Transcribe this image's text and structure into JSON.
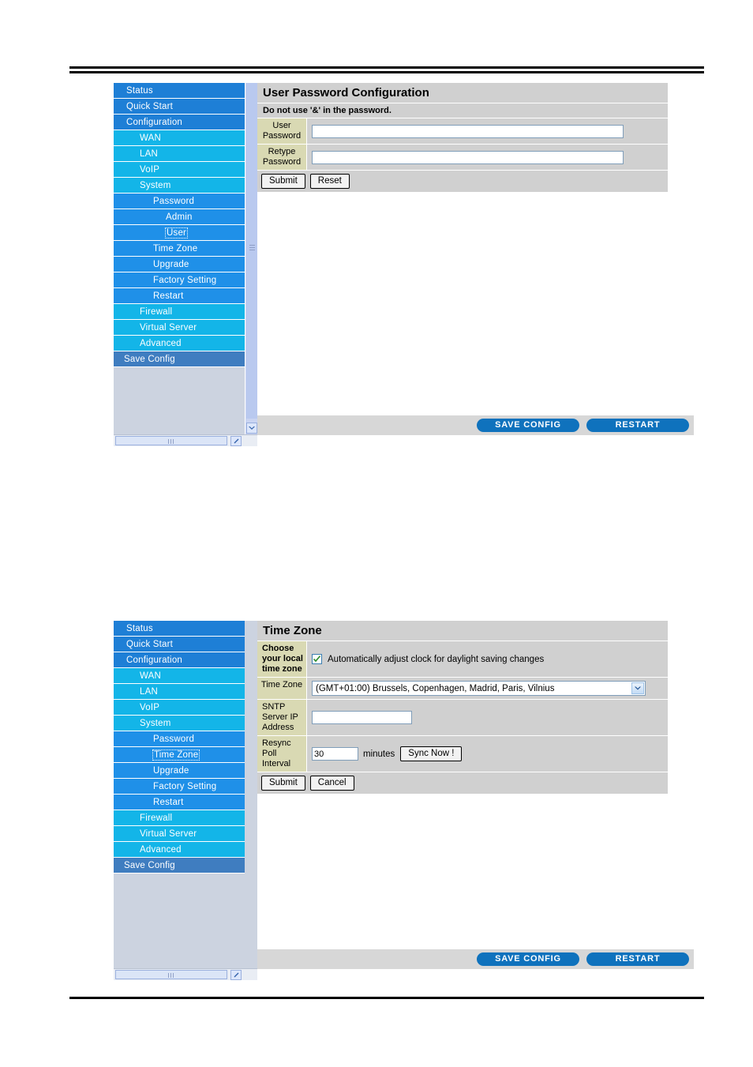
{
  "menu_top": [
    {
      "label": "Status",
      "level": 0,
      "selected": false
    },
    {
      "label": "Quick Start",
      "level": 0,
      "selected": false
    },
    {
      "label": "Configuration",
      "level": 0,
      "selected": false
    },
    {
      "label": "WAN",
      "level": 1,
      "selected": false
    },
    {
      "label": "LAN",
      "level": 1,
      "selected": false
    },
    {
      "label": "VoIP",
      "level": 1,
      "selected": false
    },
    {
      "label": "System",
      "level": 1,
      "selected": false
    },
    {
      "label": "Password",
      "level": 2,
      "selected": false
    },
    {
      "label": "Admin",
      "level": 3,
      "selected": false
    },
    {
      "label": "User",
      "level": 3,
      "selected": true
    },
    {
      "label": "Time Zone",
      "level": 2,
      "selected": false
    },
    {
      "label": "Upgrade",
      "level": 2,
      "selected": false
    },
    {
      "label": "Factory Setting",
      "level": 2,
      "selected": false
    },
    {
      "label": "Restart",
      "level": 2,
      "selected": false
    },
    {
      "label": "Firewall",
      "level": 1,
      "selected": false
    },
    {
      "label": "Virtual Server",
      "level": 1,
      "selected": false
    },
    {
      "label": "Advanced",
      "level": 1,
      "selected": false
    },
    {
      "label": "Save Config",
      "level": 9,
      "selected": false
    }
  ],
  "menu_bottom": [
    {
      "label": "Status",
      "level": 0,
      "selected": false
    },
    {
      "label": "Quick Start",
      "level": 0,
      "selected": false
    },
    {
      "label": "Configuration",
      "level": 0,
      "selected": false
    },
    {
      "label": "WAN",
      "level": 1,
      "selected": false
    },
    {
      "label": "LAN",
      "level": 1,
      "selected": false
    },
    {
      "label": "VoIP",
      "level": 1,
      "selected": false
    },
    {
      "label": "System",
      "level": 1,
      "selected": false
    },
    {
      "label": "Password",
      "level": 2,
      "selected": false
    },
    {
      "label": "Time Zone",
      "level": 2,
      "selected": true
    },
    {
      "label": "Upgrade",
      "level": 2,
      "selected": false
    },
    {
      "label": "Factory Setting",
      "level": 2,
      "selected": false
    },
    {
      "label": "Restart",
      "level": 2,
      "selected": false
    },
    {
      "label": "Firewall",
      "level": 1,
      "selected": false
    },
    {
      "label": "Virtual Server",
      "level": 1,
      "selected": false
    },
    {
      "label": "Advanced",
      "level": 1,
      "selected": false
    },
    {
      "label": "Save Config",
      "level": 9,
      "selected": false
    }
  ],
  "password_panel": {
    "title": "User Password Configuration",
    "note": "Do not use '&' in the password.",
    "user_password_label": "User Password",
    "user_password_value": "",
    "retype_password_label": "Retype Password",
    "retype_password_value": "",
    "submit_label": "Submit",
    "reset_label": "Reset"
  },
  "timezone_panel": {
    "title": "Time Zone",
    "choose_label": "Choose your local time zone",
    "dst_label": "Automatically adjust clock for daylight saving changes",
    "dst_checked": true,
    "timezone_label": "Time Zone",
    "timezone_value": "(GMT+01:00) Brussels, Copenhagen, Madrid, Paris, Vilnius",
    "sntp_label": "SNTP Server IP Address",
    "sntp_value": "",
    "resync_label": "Resync Poll Interval",
    "resync_value": "30",
    "resync_unit": "minutes",
    "sync_now_label": "Sync Now !",
    "submit_label": "Submit",
    "cancel_label": "Cancel"
  },
  "footer_bar": {
    "save_config_label": "SAVE CONFIG",
    "restart_label": "RESTART"
  },
  "colors": {
    "menu_level0": "#1e7fd6",
    "menu_level1": "#13b5e8",
    "menu_level2": "#1f90e8",
    "menu_save": "#3f7dc0",
    "label_cell": "#d9d9b3",
    "panel_bg": "#d0d0d0",
    "pill_button": "#0f72bd"
  }
}
